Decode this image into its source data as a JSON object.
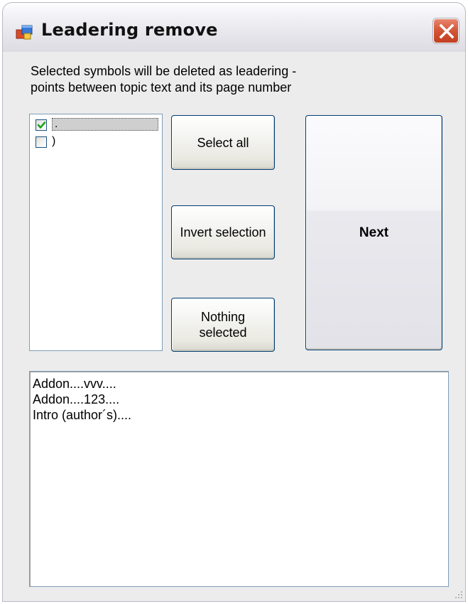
{
  "window": {
    "title": "Leadering remove",
    "icon": "window-app-icon",
    "close_icon": "close-icon"
  },
  "description": {
    "line1": "Selected symbols will be deleted as leadering -",
    "line2": "points between topic text and its page number"
  },
  "symbols": [
    {
      "label": ".",
      "checked": true,
      "selected": true
    },
    {
      "label": ")",
      "checked": false,
      "selected": false
    }
  ],
  "buttons": {
    "select_all": "Select all",
    "invert_selection": "Invert selection",
    "nothing_selected_line1": "Nothing",
    "nothing_selected_line2": "selected",
    "next": "Next"
  },
  "preview_lines": [
    "Addon....vvv....",
    "Addon....123....",
    "Intro (author´s)...."
  ],
  "colors": {
    "close_button": "#c13e22",
    "checkmark": "#21a121",
    "selection_highlight": "#cfcfcf",
    "button_border": "#003c74"
  }
}
